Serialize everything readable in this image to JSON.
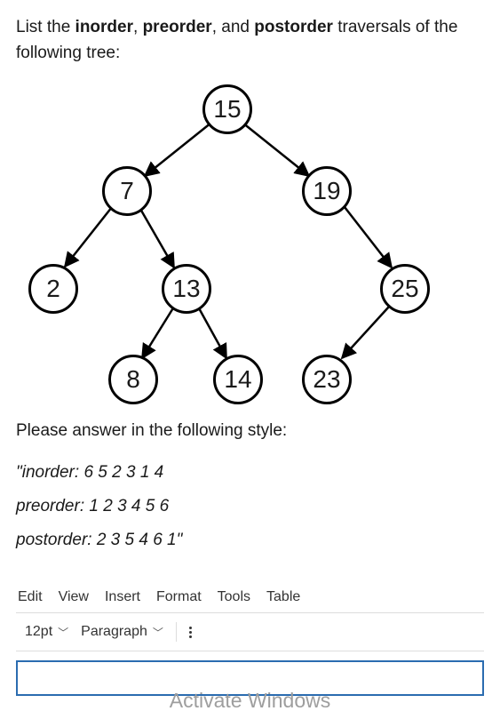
{
  "question": {
    "prefix": "List the ",
    "t1": "inorder",
    "sep1": ", ",
    "t2": "preorder",
    "sep2": ", and ",
    "t3": "postorder",
    "suffix": " traversals of the following tree:"
  },
  "tree": {
    "nodes": {
      "n15": "15",
      "n7": "7",
      "n19": "19",
      "n2": "2",
      "n13": "13",
      "n25": "25",
      "n8": "8",
      "n14": "14",
      "n23": "23"
    }
  },
  "instructions": "Please answer in the following style:",
  "example": {
    "line1": "\"inorder: 6 5 2 3 1 4",
    "line2": "preorder: 1 2 3 4 5 6",
    "line3": "postorder: 2 3 5 4 6 1\""
  },
  "editor": {
    "menus": {
      "edit": "Edit",
      "view": "View",
      "insert": "Insert",
      "format": "Format",
      "tools": "Tools",
      "table": "Table"
    },
    "fontsize": "12pt",
    "paragraph": "Paragraph"
  },
  "watermark": "Activate Windows"
}
